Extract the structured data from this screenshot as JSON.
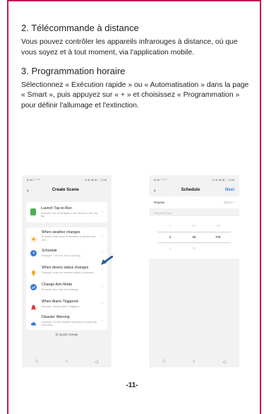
{
  "section2": {
    "heading": "2. Télécommande à distance",
    "body": "Vous pouvez contrôler les appareils infrarouges à  distance, où que vous soyez et à tout moment, via l'application mobile."
  },
  "section3": {
    "heading": "3. Programmation horaire",
    "body": "Sélectionnez « Exécution rapide » ou « Automatisation » dans la page « Smart », puis appuyez sur « + » et choisissez « Programmation » pour définir l'allumage et l'extinction."
  },
  "phone_left": {
    "status_left": "Ⅲ 4G ᵗ ᵃˡ ⁴ᴳ",
    "status_right": "⊡ ⊕ 56 ✻ ⬚ 2:56",
    "title": "Create Scene",
    "launch": {
      "title": "Launch Tap-to-Run",
      "sub": "Example: turn off all lights in the bedroom with one tap.",
      "color": "#4caf50"
    },
    "items": [
      {
        "title": "When weather changes",
        "sub": "Example: when local temperature is greater than 28°C.",
        "color": "#f5a623",
        "icon": "sun-icon"
      },
      {
        "title": "Schedule",
        "sub": "Example: 7:00 a.m. every morning.",
        "color": "#3d7bd9",
        "icon": "clock-icon"
      },
      {
        "title": "When device status changes",
        "sub": "Example: when an unusual activity is detected.",
        "color": "#f5a623",
        "icon": "bulb-icon"
      },
      {
        "title": "Change Arm Mode",
        "sub": "Example: Arm Stay Via Gateway",
        "color": "#3d7bd9",
        "icon": "check-shield-icon"
      },
      {
        "title": "When Alarm Triggered",
        "sub": "Example: Smoke Alarm Triggered",
        "color": "#e53935",
        "icon": "alarm-icon"
      },
      {
        "title": "Disaster Warning",
        "sub": "Example: 24-hour disaster warning for heavy rain and snow.",
        "color": "#3d7bd9",
        "icon": "cloud-icon"
      }
    ],
    "quick_create": "⊡ Quick Create",
    "sysnav": [
      "□",
      "○",
      "◁"
    ]
  },
  "phone_right": {
    "status_left": "Ⅲ 4G ᵗ ᵃˡ ⁴ᴳ",
    "status_right": "⊡ ⊕ 56 ✻ ⬚ 2:56",
    "title": "Schedule",
    "next": "Next",
    "repeat_label": "Repeat",
    "repeat_value": "Once >",
    "exec_label": "Execution Time",
    "picker": {
      "hours": [
        "1",
        "2",
        "3"
      ],
      "minutes": [
        "57",
        "58",
        "59"
      ],
      "ampm": [
        "AM",
        "PM",
        ""
      ]
    },
    "sysnav": [
      "□",
      "○",
      "◁"
    ]
  },
  "page_number": "-11-",
  "colors": {
    "frame": "#c2185b",
    "accent": "#3b7fe0",
    "arrow": "#2b5f9e"
  }
}
